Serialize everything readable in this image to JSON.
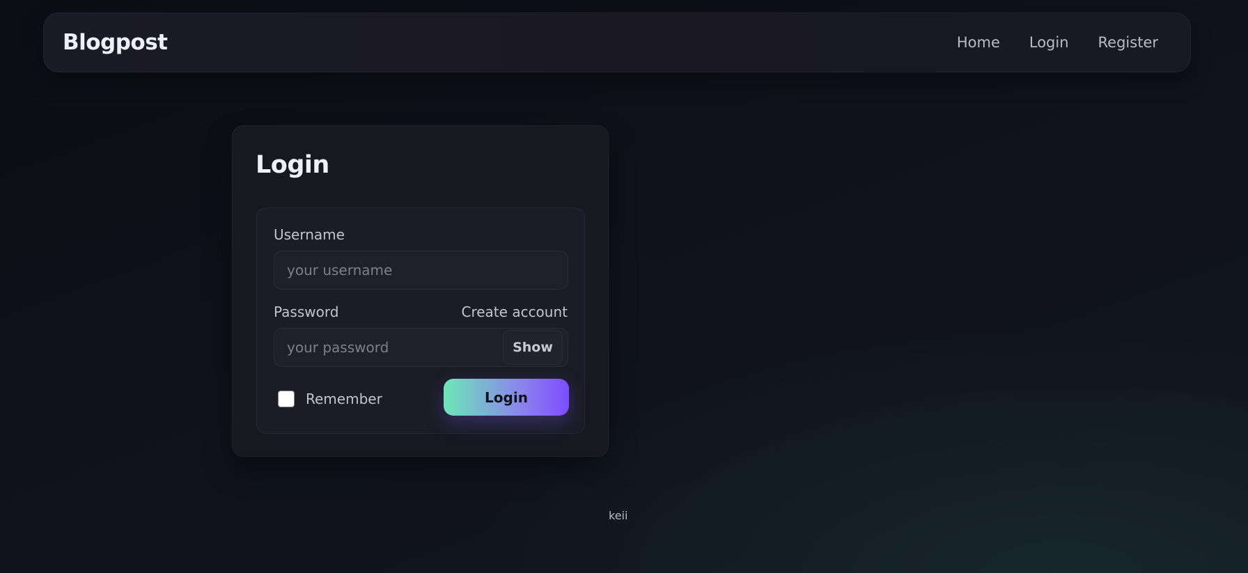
{
  "nav": {
    "brand": "Blogpost",
    "links": [
      "Home",
      "Login",
      "Register"
    ]
  },
  "login_card": {
    "title": "Login",
    "username": {
      "label": "Username",
      "placeholder": "your username",
      "value": ""
    },
    "password": {
      "label": "Password",
      "placeholder": "your password",
      "value": "",
      "show_label": "Show"
    },
    "create_account_label": "Create account",
    "remember_label": "Remember",
    "remember_checked": false,
    "submit_label": "Login"
  },
  "footer": {
    "text": "keii"
  },
  "colors": {
    "accent_gradient_start": "#6ee7b7",
    "accent_gradient_end": "#7c4dff"
  }
}
